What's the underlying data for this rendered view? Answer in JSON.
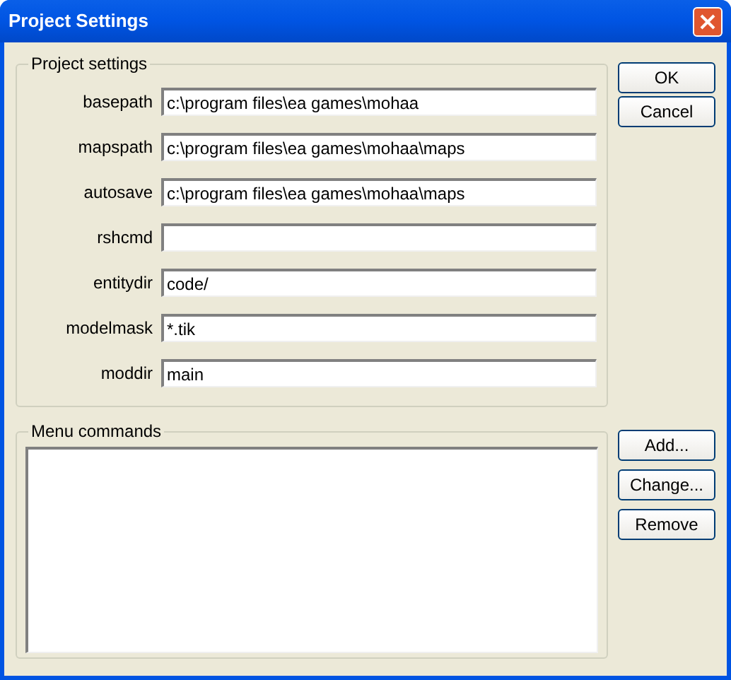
{
  "window": {
    "title": "Project Settings"
  },
  "project_settings": {
    "title": "Project settings",
    "fields": [
      {
        "label": "basepath",
        "value": "c:\\program files\\ea games\\mohaa"
      },
      {
        "label": "mapspath",
        "value": "c:\\program files\\ea games\\mohaa\\maps"
      },
      {
        "label": "autosave",
        "value": "c:\\program files\\ea games\\mohaa\\maps"
      },
      {
        "label": "rshcmd"
      },
      {
        "label": "entitydir",
        "value": "code/"
      },
      {
        "label": "modelmask",
        "value": "*.tik"
      },
      {
        "label": "moddir",
        "value": "main"
      }
    ]
  },
  "dialog_buttons": [
    "OK",
    "Cancel"
  ],
  "menu_commands": {
    "title": "Menu commands"
  },
  "menu_buttons": [
    "Add...",
    "Change...",
    "Remove"
  ]
}
